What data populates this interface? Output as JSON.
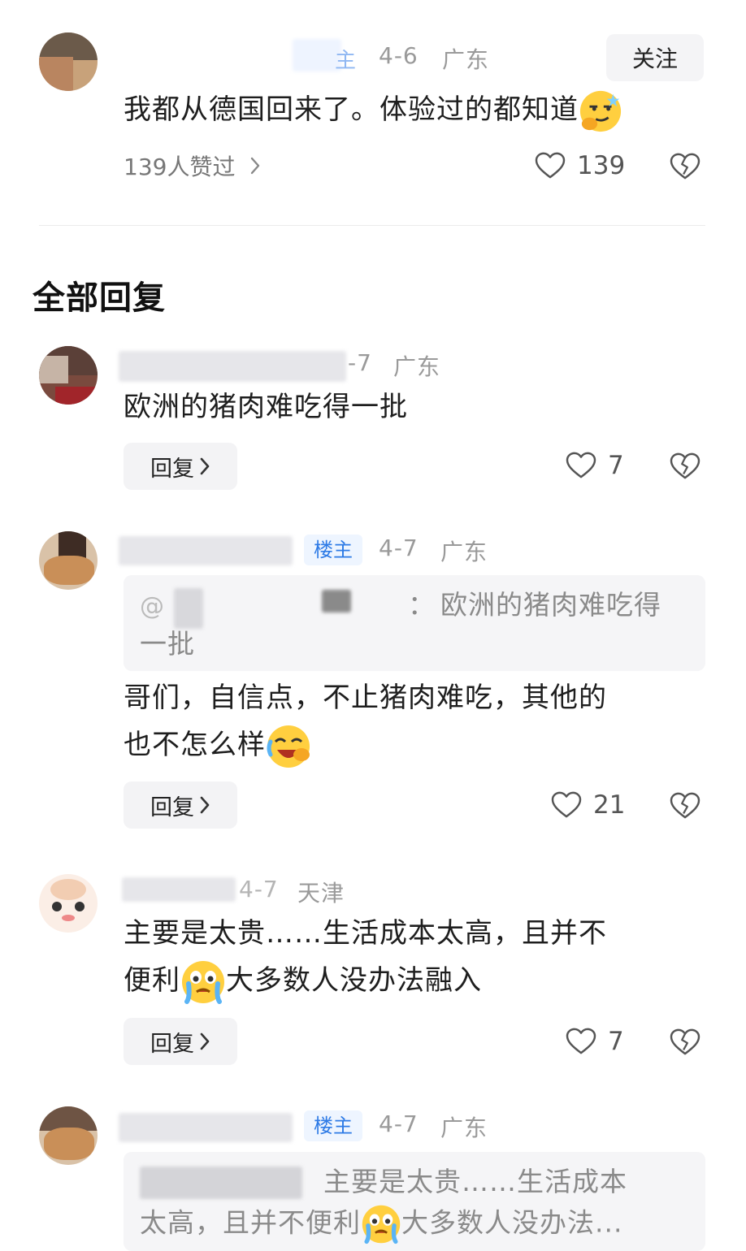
{
  "top_comment": {
    "badge": "主",
    "date": "4-6",
    "location": "广东",
    "follow_label": "关注",
    "text": "我都从德国回来了。体验过的都知道",
    "likes_summary": "139人赞过",
    "like_count": "139"
  },
  "section_title": "全部回复",
  "replies": [
    {
      "date": "-7",
      "location": "广东",
      "text": "欧洲的猪肉难吃得一批",
      "reply_label": "回复",
      "like_count": "7"
    },
    {
      "badge": "楼主",
      "date": "4-7",
      "location": "广东",
      "quote_colon": "：",
      "quote_text": "欧洲的猪肉难吃得",
      "quote_text_2": "一批",
      "text": "哥们，自信点，不止猪肉难吃，其他的",
      "text_2": "也不怎么样",
      "reply_label": "回复",
      "like_count": "21"
    },
    {
      "date": "4-7",
      "location": "天津",
      "text": "主要是太贵……生活成本太高，且并不",
      "text_2a": "便利",
      "text_2b": "大多数人没办法融入",
      "reply_label": "回复",
      "like_count": "7"
    },
    {
      "badge": "楼主",
      "date": "4-7",
      "location": "广东",
      "quote_text": "主要是太贵……生活成本",
      "quote_text_2a": "太高，且并不便利",
      "quote_text_2b": "大多数人没办法..."
    }
  ],
  "icons": {
    "heart": "heart-outline-icon",
    "dislike": "broken-heart-icon",
    "chevron": "chevron-right-icon",
    "emojis": [
      "smug-emoji",
      "laugh-cry-emoji",
      "cry-emoji"
    ]
  }
}
